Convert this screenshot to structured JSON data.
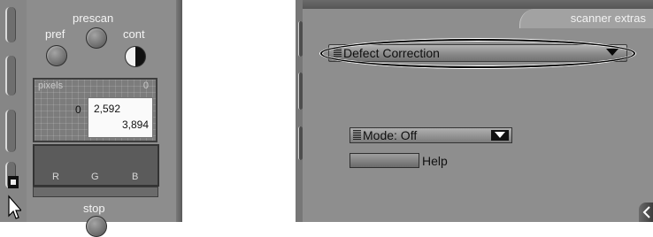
{
  "left_panel": {
    "prescan_label": "prescan",
    "pref_label": "pref",
    "cont_label": "cont",
    "pixels": {
      "title": "pixels",
      "corner_value": "0",
      "origin_value": "0",
      "width_value": "2,592",
      "height_value": "3,894"
    },
    "channels": [
      "R",
      "G",
      "B"
    ],
    "stop_label": "stop"
  },
  "right_panel": {
    "tab_label": "scanner extras",
    "dropdown": {
      "label": "Defect Correction"
    },
    "mode_select": {
      "label": "Mode: Off"
    },
    "help_label": "Help"
  },
  "colors": {
    "panel_gray": "#8d8d8d",
    "text_light": "#f4f4f4",
    "highlight_oval": "#000000"
  },
  "icons": [
    "knob-icon",
    "contrast-icon",
    "grip-icon",
    "dropdown-arrow-icon",
    "cursor-icon",
    "side-arrow-icon"
  ]
}
